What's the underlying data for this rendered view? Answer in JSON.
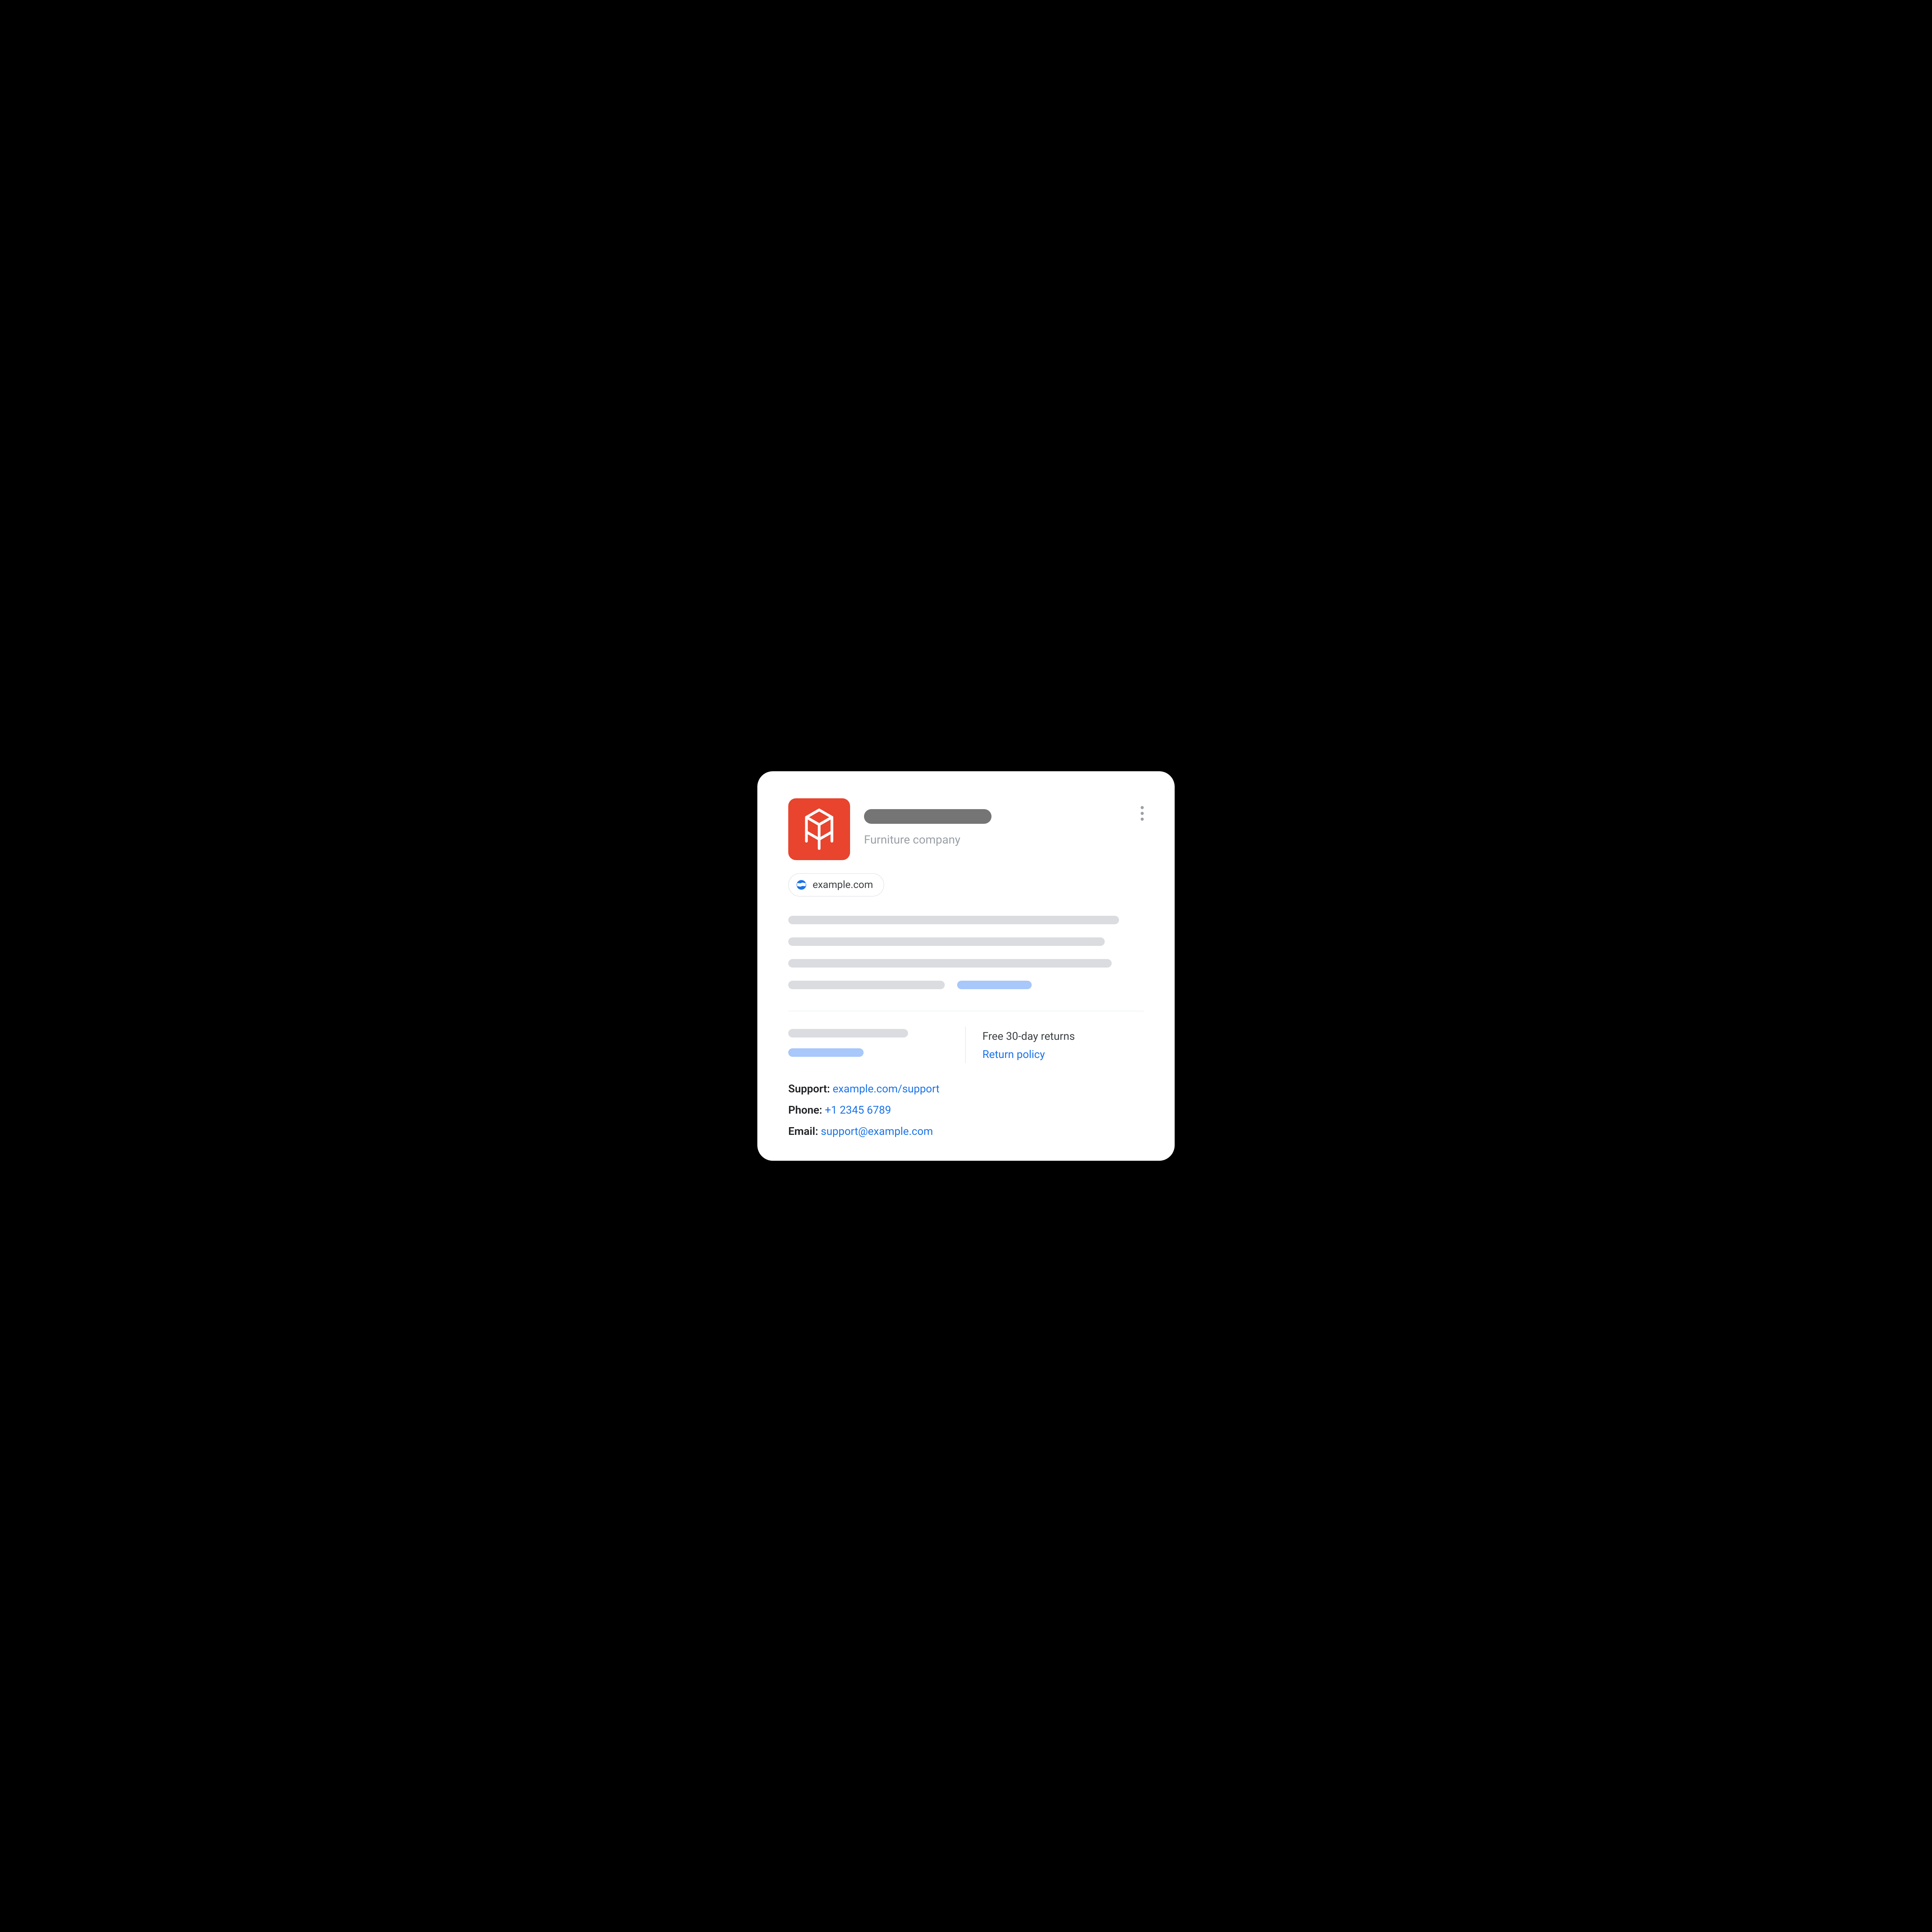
{
  "header": {
    "subtitle": "Furniture company"
  },
  "website_chip": {
    "label": "example.com"
  },
  "returns": {
    "headline": "Free 30-day returns",
    "policy_link_label": "Return policy"
  },
  "contact": {
    "support_label": "Support:",
    "support_value": "example.com/support",
    "phone_label": "Phone:",
    "phone_value": "+1 2345 6789",
    "email_label": "Email:",
    "email_value": "support@example.com"
  }
}
